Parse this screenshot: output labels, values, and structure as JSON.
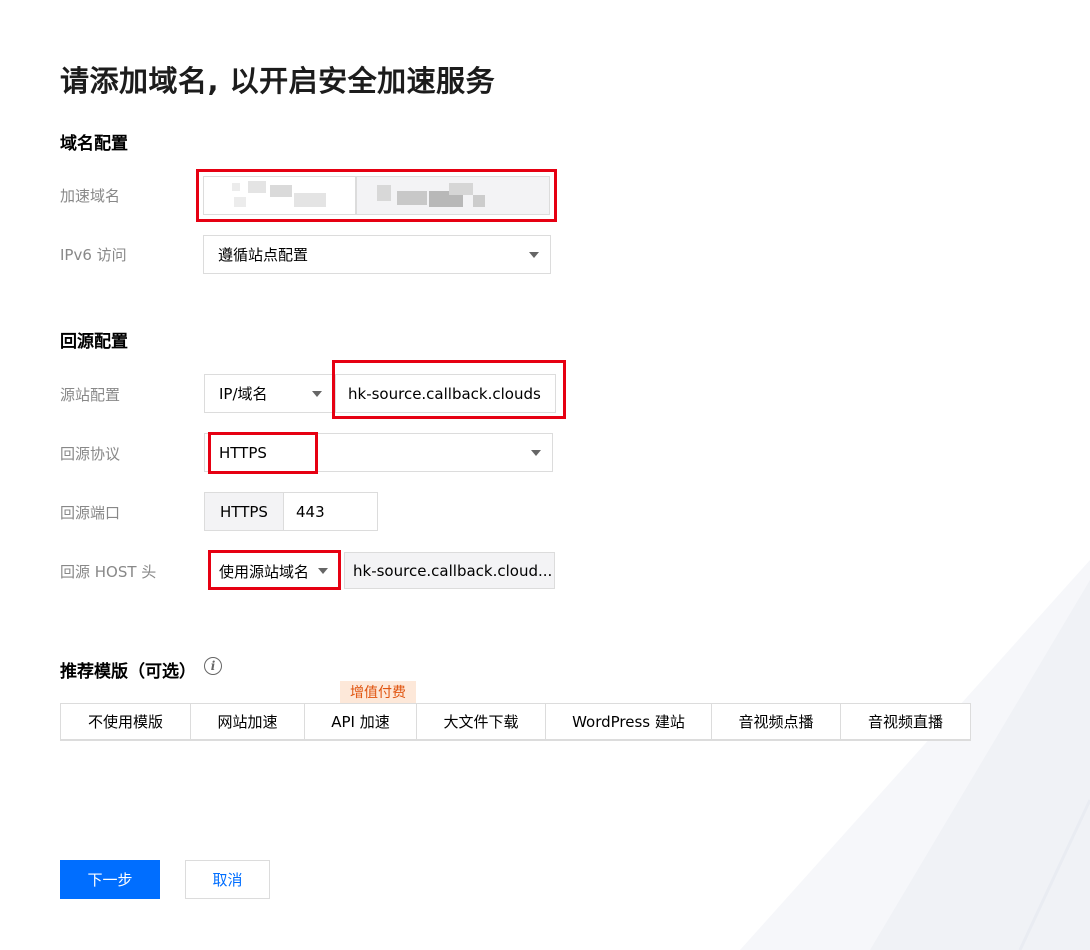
{
  "page": {
    "title": "请添加域名, 以开启安全加速服务"
  },
  "domain_config": {
    "section_title": "域名配置",
    "accelerate_domain": {
      "label": "加速域名"
    },
    "ipv6": {
      "label": "IPv6 访问",
      "value": "遵循站点配置"
    }
  },
  "origin_config": {
    "section_title": "回源配置",
    "origin_site": {
      "label": "源站配置",
      "type_value": "IP/域名",
      "address_value": "hk-source.callback.clouds"
    },
    "protocol": {
      "label": "回源协议",
      "value": "HTTPS"
    },
    "port": {
      "label": "回源端口",
      "prefix": "HTTPS",
      "value": "443"
    },
    "host_header": {
      "label": "回源 HOST 头",
      "mode_value": "使用源站域名",
      "value": "hk-source.callback.cloud..."
    }
  },
  "templates": {
    "section_title": "推荐模版（可选）",
    "info_icon": "info-circle-icon",
    "paid_badge": "增值付费",
    "items": [
      "不使用模版",
      "网站加速",
      "API 加速",
      "大文件下载",
      "WordPress 建站",
      "音视频点播",
      "音视频直播"
    ]
  },
  "actions": {
    "next_label": "下一步",
    "cancel_label": "取消"
  },
  "colors": {
    "primary": "#006eff",
    "highlight_red": "#e60012",
    "badge_bg": "#fde8d9",
    "badge_text": "#e0540f"
  }
}
